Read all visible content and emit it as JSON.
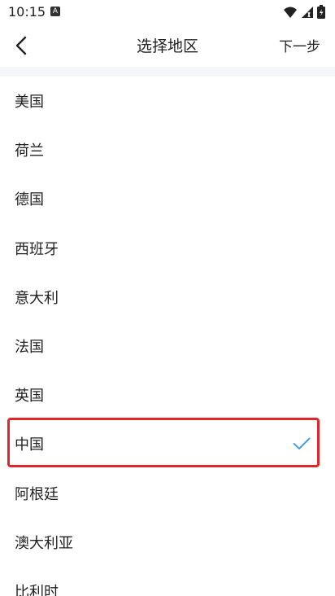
{
  "status_bar": {
    "time": "10:15",
    "notification_glyph": "A"
  },
  "nav": {
    "title": "选择地区",
    "next_label": "下一步"
  },
  "regions": [
    {
      "label": "美国",
      "selected": false
    },
    {
      "label": "荷兰",
      "selected": false
    },
    {
      "label": "德国",
      "selected": false
    },
    {
      "label": "西班牙",
      "selected": false
    },
    {
      "label": "意大利",
      "selected": false
    },
    {
      "label": "法国",
      "selected": false
    },
    {
      "label": "英国",
      "selected": false
    },
    {
      "label": "中国",
      "selected": true
    },
    {
      "label": "阿根廷",
      "selected": false
    },
    {
      "label": "澳大利亚",
      "selected": false
    },
    {
      "label": "比利时",
      "selected": false
    }
  ],
  "colors": {
    "check": "#4a9fe0",
    "highlight": "#e0262a",
    "divider": "#f3f5f8"
  }
}
